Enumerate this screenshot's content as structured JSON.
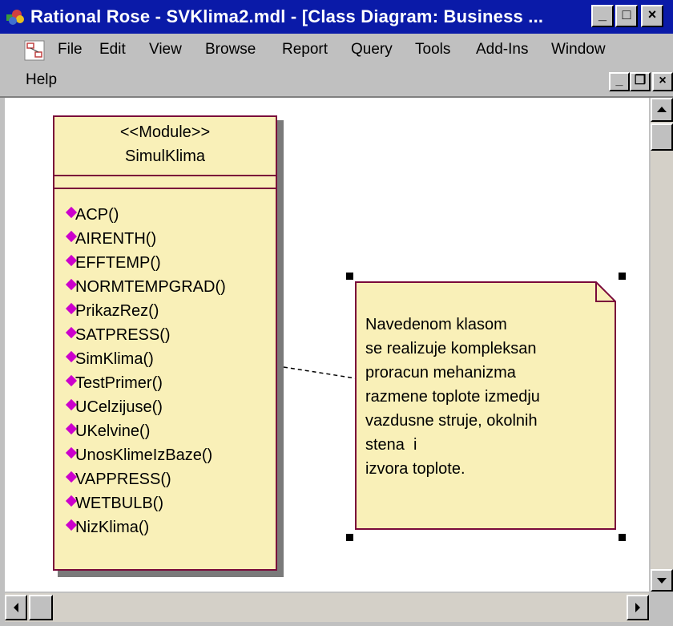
{
  "window": {
    "title": "Rational Rose - SVKlima2.mdl - [Class Diagram: Business ...",
    "min_label": "_",
    "max_label": "□",
    "close_label": "×"
  },
  "menu": {
    "items": [
      "File",
      "Edit",
      "View",
      "Browse",
      "Report",
      "Query",
      "Tools",
      "Add-Ins",
      "Window"
    ],
    "help": "Help",
    "mdi_min": "_",
    "mdi_restore": "❐",
    "mdi_close": "×"
  },
  "diagram": {
    "class": {
      "stereotype": "<<Module>>",
      "name": "SimulKlima",
      "operations": [
        "ACP()",
        "AIRENTH()",
        "EFFTEMP()",
        "NORMTEMPGRAD()",
        "PrikazRez()",
        "SATPRESS()",
        "SimKlima()",
        "TestPrimer()",
        "UCelzijuse()",
        "UKelvine()",
        "UnosKlimeIzBaze()",
        "VAPPRESS()",
        "WETBULB()",
        "NizKlima()"
      ],
      "operation_icon": "operation-diamond-icon",
      "border_color": "#7a0a3a",
      "fill_color": "#f9f0b8"
    },
    "note": {
      "text": "Navedenom klasom\nse realizuje kompleksan\nproracun mehanizma\nrazmene toplote izmedju\nvazdusne struje, okolnih\nstena  i\nizvora toplote."
    }
  },
  "icons": {
    "app": "rational-rose-icon",
    "doc": "class-diagram-icon"
  }
}
